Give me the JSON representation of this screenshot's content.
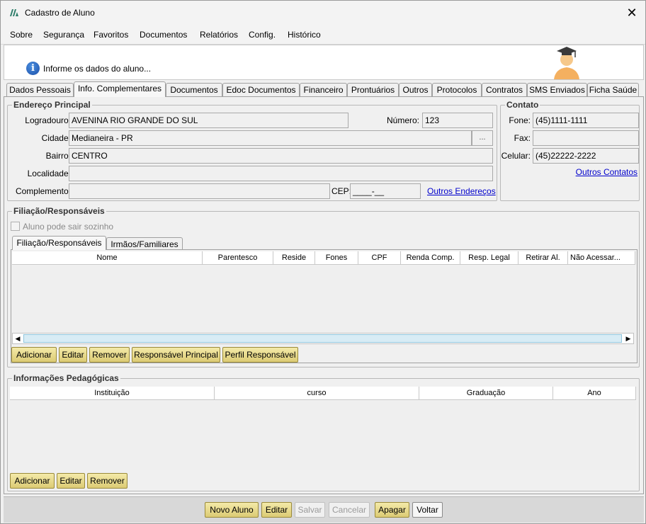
{
  "window": {
    "title": "Cadastro de Aluno"
  },
  "menu": [
    {
      "label": "Sobre"
    },
    {
      "label": "Segurança"
    },
    {
      "label": "Favoritos"
    },
    {
      "label": "Documentos"
    },
    {
      "label": "Relatórios"
    },
    {
      "label": "Config."
    },
    {
      "label": "Histórico"
    }
  ],
  "banner": {
    "text": "Informe os dados do aluno..."
  },
  "tabs": [
    {
      "label": "Dados Pessoais"
    },
    {
      "label": "Info. Complementares",
      "active": true
    },
    {
      "label": "Documentos"
    },
    {
      "label": "Edoc Documentos"
    },
    {
      "label": "Financeiro"
    },
    {
      "label": "Prontuários"
    },
    {
      "label": "Outros"
    },
    {
      "label": "Protocolos"
    },
    {
      "label": "Contratos"
    },
    {
      "label": "SMS Enviados"
    },
    {
      "label": "Ficha Saúde"
    }
  ],
  "endereco": {
    "title": "Endereço Principal",
    "logradouro_label": "Logradouro:",
    "logradouro": "AVENINA RIO GRANDE DO SUL",
    "numero_label": "Número:",
    "numero": "123",
    "cidade_label": "Cidade:",
    "cidade": "Medianeira - PR",
    "cidade_btn": "...",
    "bairro_label": "Bairro:",
    "bairro": "CENTRO",
    "localidade_label": "Localidade:",
    "localidade": "",
    "complemento_label": "Complemento:",
    "complemento": "",
    "cep_label": "CEP:",
    "cep": "____-__",
    "outros_link": "Outros Endereços"
  },
  "contato": {
    "title": "Contato",
    "fone_label": "Fone:",
    "fone": "(45)1111-1111",
    "fax_label": "Fax:",
    "fax": "",
    "celular_label": "Celular:",
    "celular": "(45)22222-2222",
    "outros_link": "Outros Contatos"
  },
  "filiacao": {
    "title": "Filiação/Responsáveis",
    "checkbox_label": "Aluno pode sair sozinho",
    "subtabs": [
      {
        "label": "Filiação/Responsáveis",
        "active": true
      },
      {
        "label": "Irmãos/Familiares"
      }
    ],
    "columns": [
      "Nome",
      "Parentesco",
      "Reside",
      "Fones",
      "CPF",
      "Renda Comp.",
      "Resp. Legal",
      "Retirar Al.",
      "Não Acessar..."
    ],
    "buttons": {
      "adicionar": "Adicionar",
      "editar": "Editar",
      "remover": "Remover",
      "resp_principal": "Responsável Principal",
      "perfil": "Perfil Responsável"
    }
  },
  "pedagogicas": {
    "title": "Informações Pedagógicas",
    "columns": [
      "Instituição",
      "curso",
      "Graduação",
      "Ano"
    ],
    "buttons": {
      "adicionar": "Adicionar",
      "editar": "Editar",
      "remover": "Remover"
    }
  },
  "footer": {
    "novo": "Novo Aluno",
    "editar": "Editar",
    "salvar": "Salvar",
    "cancelar": "Cancelar",
    "apagar": "Apagar",
    "voltar": "Voltar"
  },
  "colors": {
    "button_gold": "#dccb74",
    "link": "#0000cc",
    "info_blue": "#1c4fa8"
  }
}
